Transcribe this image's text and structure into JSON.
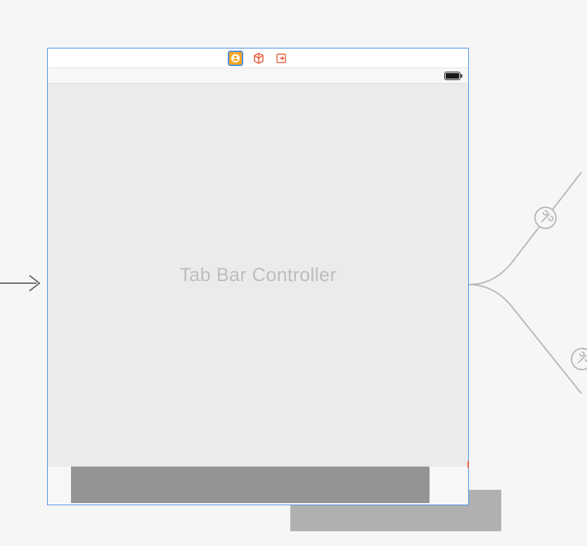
{
  "scene": {
    "placeholder_label": "Tab Bar Controller",
    "dock": {
      "icons": [
        "view-controller-icon",
        "first-responder-icon",
        "exit-icon"
      ]
    },
    "status_bar": {
      "battery_icon": "battery-full-icon"
    }
  },
  "colors": {
    "selection_blue": "#4a90e2",
    "dock_orange": "#e85d3f",
    "vc_gold": "#f5a623",
    "canvas_bg": "#f6f6f6",
    "placeholder_text": "#bdbdbd"
  }
}
